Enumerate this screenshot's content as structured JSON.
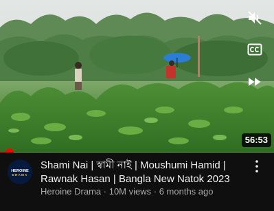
{
  "player": {
    "duration": "56:53",
    "progress_fraction": 0.035,
    "controls": {
      "mute_icon": "volume-muted-icon",
      "captions_icon": "closed-captions-icon",
      "fast_forward_icon": "fast-forward-icon"
    },
    "colors": {
      "progress": "#ff0000"
    }
  },
  "video": {
    "title": "Shami Nai | স্বামী নাই | Moushumi Hamid | Rawnak Hasan | Bangla New Natok 2023",
    "channel": "Heroine Drama",
    "views": "10M views",
    "age": "6 months ago",
    "separator": " · ",
    "avatar_logo_text": [
      "HEROINE",
      "DRAMA"
    ],
    "more_icon": "more-vertical-icon"
  }
}
